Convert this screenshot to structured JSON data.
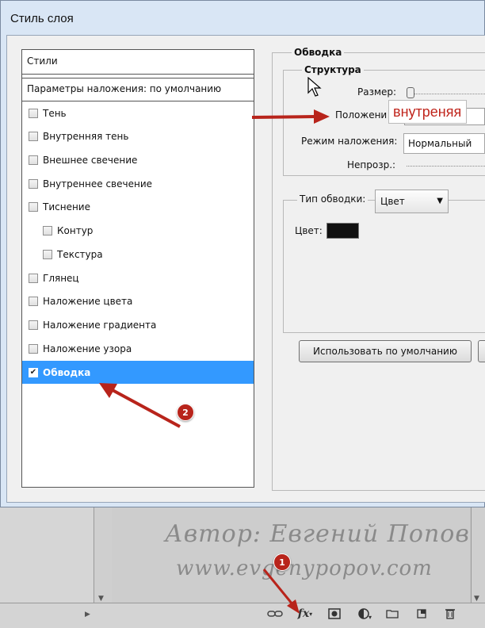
{
  "background": {
    "watermark_line1": "Автор: Евгений Попов",
    "watermark_line2": "www.evgenypopov.com",
    "toolbar_icons": [
      "link-icon",
      "fx-icon",
      "mask-icon",
      "adjustment-icon",
      "folder-icon",
      "new-layer-icon",
      "trash-icon"
    ],
    "fx_label": "fx"
  },
  "dialog": {
    "title": "Стиль слоя"
  },
  "styles_panel": {
    "header": "Стили",
    "blending_options": "Параметры наложения: по умолчанию",
    "items": [
      {
        "label": "Тень",
        "checked": false,
        "sub": false
      },
      {
        "label": "Внутренняя тень",
        "checked": false,
        "sub": false
      },
      {
        "label": "Внешнее свечение",
        "checked": false,
        "sub": false
      },
      {
        "label": "Внутреннее свечение",
        "checked": false,
        "sub": false
      },
      {
        "label": "Тиснение",
        "checked": false,
        "sub": false
      },
      {
        "label": "Контур",
        "checked": false,
        "sub": true
      },
      {
        "label": "Текстура",
        "checked": false,
        "sub": true
      },
      {
        "label": "Глянец",
        "checked": false,
        "sub": false
      },
      {
        "label": "Наложение цвета",
        "checked": false,
        "sub": false
      },
      {
        "label": "Наложение градиента",
        "checked": false,
        "sub": false
      },
      {
        "label": "Наложение узора",
        "checked": false,
        "sub": false
      },
      {
        "label": "Обводка",
        "checked": true,
        "sub": false,
        "selected": true
      }
    ]
  },
  "stroke": {
    "section_title": "Обводка",
    "structure_title": "Структура",
    "size_label": "Размер:",
    "position_label": "Положени",
    "position_overlay": "внутреняя",
    "blend_mode_label": "Режим наложения:",
    "blend_mode_value": "Нормальный",
    "opacity_label": "Непрозр.:",
    "fill_type_label": "Тип обводки:",
    "fill_type_value": "Цвет",
    "color_label": "Цвет:",
    "color_value": "#111111",
    "default_button": "Использовать по умолчанию"
  },
  "annotations": {
    "badge_1": "1",
    "badge_2": "2",
    "arrow_color": "#b8241b"
  }
}
